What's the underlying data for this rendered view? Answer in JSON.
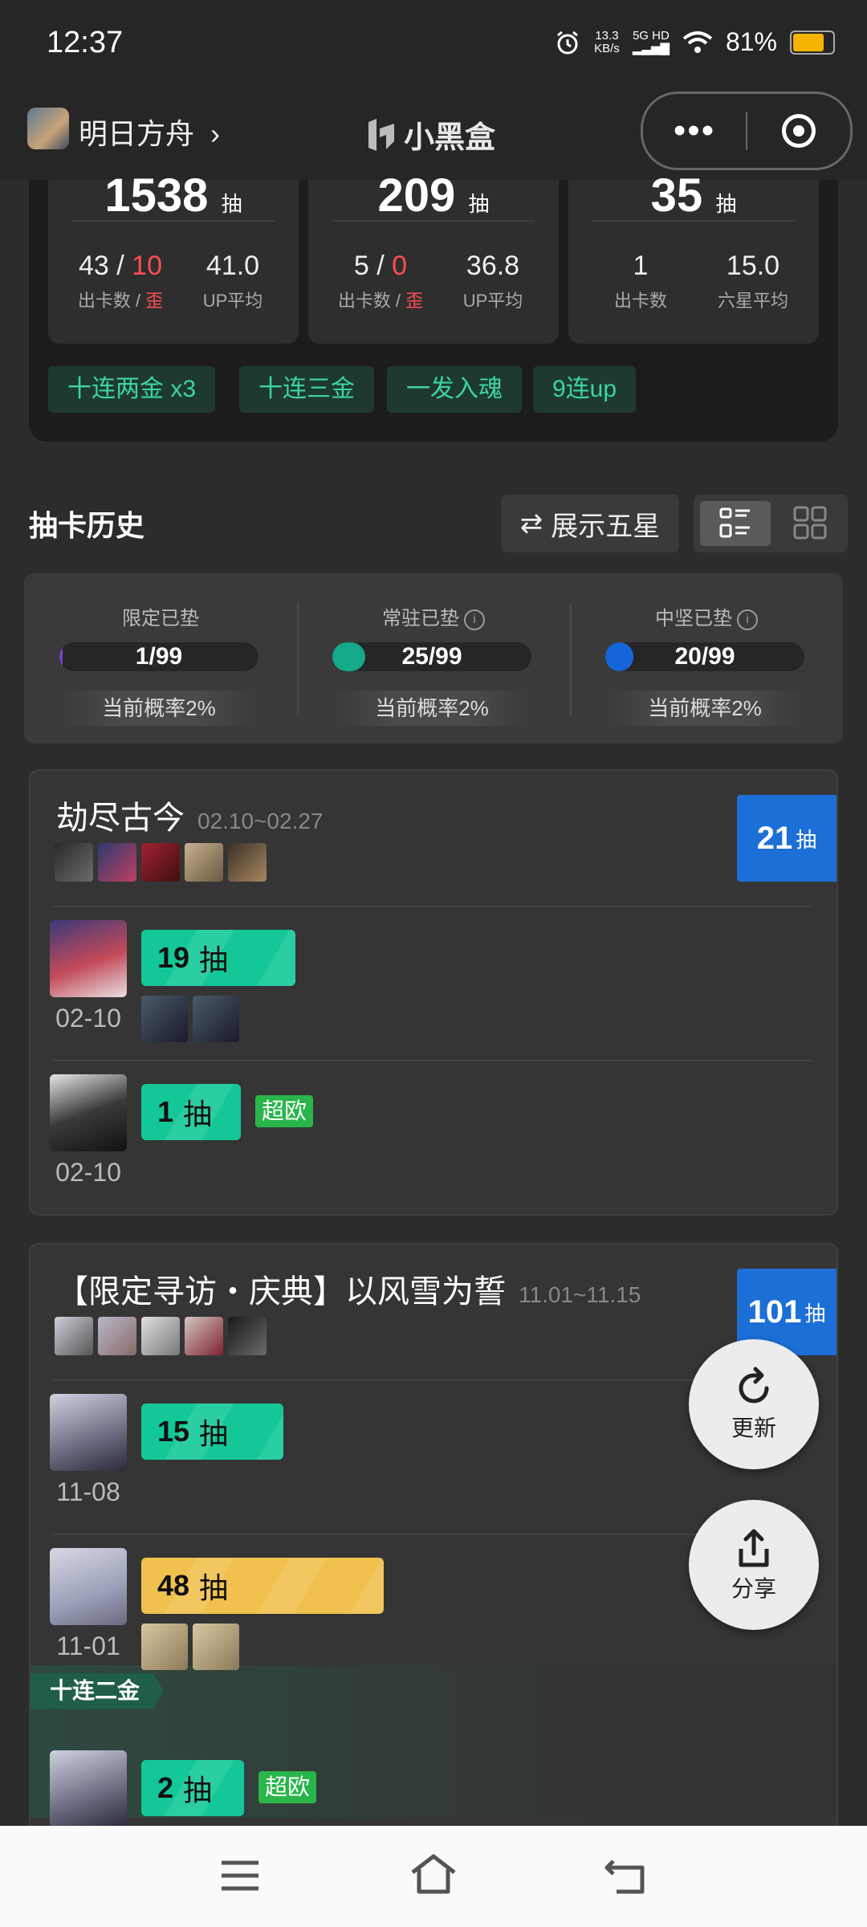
{
  "status_bar": {
    "time": "12:37",
    "net_speed": "13.3",
    "net_unit": "KB/s",
    "signal_label": "5G HD",
    "battery": "81%"
  },
  "nav": {
    "game": "明日方舟",
    "app_name": "小黑盒"
  },
  "summary": {
    "cards": [
      {
        "total": "1538",
        "unit": "抽",
        "left_value_a": "43",
        "left_value_sep": " / ",
        "left_value_b": "10",
        "left_label_a": "出卡数 / ",
        "left_label_b": "歪",
        "right_value": "41.0",
        "right_label": "UP平均"
      },
      {
        "total": "209",
        "unit": "抽",
        "left_value_a": "5",
        "left_value_sep": " / ",
        "left_value_b": "0",
        "left_label_a": "出卡数 / ",
        "left_label_b": "歪",
        "right_value": "36.8",
        "right_label": "UP平均"
      },
      {
        "total": "35",
        "unit": "抽",
        "left_value_a": "1",
        "left_value_sep": "",
        "left_value_b": "",
        "left_label_a": "出卡数",
        "left_label_b": "",
        "right_value": "15.0",
        "right_label": "六星平均"
      }
    ],
    "chips": [
      "十连两金  x3",
      "十连三金",
      "一发入魂",
      "9连up"
    ]
  },
  "history": {
    "title": "抽卡历史",
    "toggle_label": "展示五星",
    "pity": [
      {
        "label": "限定已垫",
        "value": "1/99",
        "fraction": 0.0101,
        "color": "#7a3fd0",
        "rate": "当前概率2%",
        "info": false
      },
      {
        "label": "常驻已垫",
        "value": "25/99",
        "fraction": 0.2525,
        "color": "#14a98a",
        "rate": "当前概率2%",
        "info": true
      },
      {
        "label": "中坚已垫",
        "value": "20/99",
        "fraction": 0.202,
        "color": "#1565d8",
        "rate": "当前概率2%",
        "info": true
      }
    ]
  },
  "banners": [
    {
      "name": "劫尽古今",
      "dates": "02.10~02.27",
      "count": "21",
      "unit": "抽",
      "pulls": [
        {
          "date": "02-10",
          "count": "19",
          "unit": "抽",
          "color": "green",
          "fraction": 0.19
        },
        {
          "date": "02-10",
          "count": "1",
          "unit": "抽",
          "color": "green",
          "badge": "超欧",
          "fraction": 0.01
        }
      ]
    },
    {
      "name": "【限定寻访・庆典】以风雪为誓",
      "dates": "11.01~11.15",
      "count": "101",
      "unit": "抽",
      "pulls": [
        {
          "date": "11-08",
          "count": "15",
          "unit": "抽",
          "color": "green",
          "fraction": 0.15
        },
        {
          "date": "11-01",
          "count": "48",
          "unit": "抽",
          "color": "yellow",
          "fraction": 0.48
        },
        {
          "date": "",
          "count": "2",
          "unit": "抽",
          "color": "green",
          "badge": "超欧",
          "tag": "十连二金",
          "fraction": 0.02
        }
      ]
    }
  ],
  "fab": {
    "refresh": "更新",
    "share": "分享"
  },
  "icons": [
    "alarm-icon",
    "wifi-icon",
    "battery-icon",
    "chevron-right-icon",
    "logo-icon",
    "more-icon",
    "target-icon",
    "swap-icon",
    "list-view-icon",
    "grid-view-icon",
    "info-icon",
    "refresh-icon",
    "share-icon",
    "menu-icon",
    "home-icon",
    "back-icon"
  ]
}
